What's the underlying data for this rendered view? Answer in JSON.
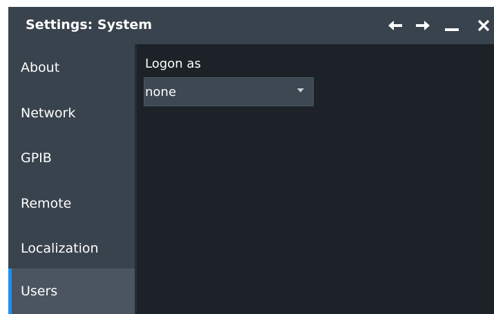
{
  "window": {
    "title": "Settings: System",
    "controls": [
      "back",
      "forward",
      "minimize",
      "close"
    ]
  },
  "sidebar": {
    "items": [
      {
        "label": "About"
      },
      {
        "label": "Network"
      },
      {
        "label": "GPIB"
      },
      {
        "label": "Remote"
      },
      {
        "label": "Localization"
      },
      {
        "label": "Users",
        "selected": true
      }
    ]
  },
  "main": {
    "logon_label": "Logon as",
    "logon_value": "none"
  },
  "colors": {
    "titlebar": "#39434d",
    "sidebar": "#39434d",
    "content": "#1c2227",
    "accent": "#1f8ff0",
    "selected_item": "#4a5561"
  },
  "icons": [
    "back-arrow-icon",
    "forward-arrow-icon",
    "minimize-icon",
    "close-icon",
    "chevron-down-icon"
  ]
}
